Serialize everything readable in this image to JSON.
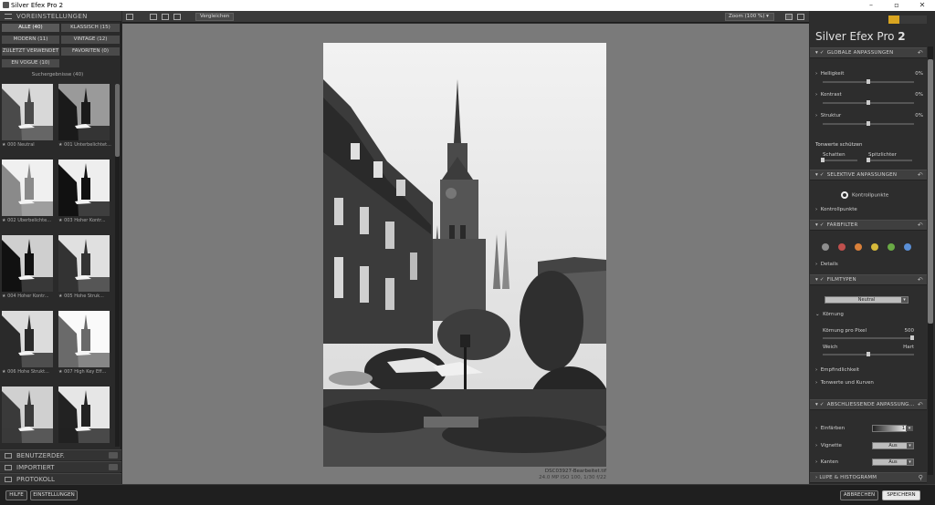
{
  "window": {
    "title": "Silver Efex Pro 2",
    "controls": [
      "–",
      "▫",
      "✕"
    ]
  },
  "left_panel": {
    "header": "VOREINSTELLUNGEN",
    "tabs": [
      {
        "label": "ALLE (40)"
      },
      {
        "label": "KLASSISCH (15)"
      },
      {
        "label": "MODERN (11)"
      },
      {
        "label": "VINTAGE (12)"
      },
      {
        "label": "ZULETZT VERWENDET"
      },
      {
        "label": "FAVORITEN (0)"
      },
      {
        "label": "EN VOGUE (10)"
      }
    ],
    "search_results": "Suchergebnisse (40)",
    "presets": [
      {
        "label": "★ 000 Neutral"
      },
      {
        "label": "★ 001 Unterbelichtet..."
      },
      {
        "label": "★ 002 Überbelichte..."
      },
      {
        "label": "★ 003 Hoher Kontr..."
      },
      {
        "label": "★ 004 Hoher Kontr..."
      },
      {
        "label": "★ 005 Hohe Struk..."
      },
      {
        "label": "★ 006 Hohe Strukt..."
      },
      {
        "label": "★ 007 High Key Eff..."
      },
      {
        "label": ""
      },
      {
        "label": ""
      }
    ],
    "sections": [
      {
        "label": "BENUTZERDEF."
      },
      {
        "label": "IMPORTIERT"
      },
      {
        "label": "PROTOKOLL"
      }
    ]
  },
  "toolbar": {
    "compare_label": "Vergleichen",
    "zoom_label": "Zoom (100 %)"
  },
  "canvas": {
    "filename": "DSC03927-Bearbeitet.tif",
    "meta": "24.0 MP ISO 100, 1/30 f/22"
  },
  "right_panel": {
    "brand_name": "Silver Efex Pro",
    "brand_version": "2",
    "global": {
      "header": "GLOBALE ANPASSUNGEN",
      "sliders": [
        {
          "label": "Helligkeit",
          "value": "0%",
          "level": 0.5
        },
        {
          "label": "Kontrast",
          "value": "0%",
          "level": 0.5
        },
        {
          "label": "Struktur",
          "value": "0%",
          "level": 0.5
        }
      ],
      "protect_title": "Tonwerte schützen",
      "protect_shadows": "Schatten",
      "protect_highlights": "Spitzlichter"
    },
    "selective": {
      "header": "SELEKTIVE ANPASSUNGEN",
      "control_points_button": "Kontrollpunkte",
      "control_points_label": "Kontrollpunkte"
    },
    "color_filter": {
      "header": "FARBFILTER",
      "dots": [
        "#8e8e8e",
        "#c0504d",
        "#d9803a",
        "#d6b93a",
        "#6aaa45",
        "#5a8fd6"
      ],
      "details": "Details"
    },
    "film": {
      "header": "FILMTYPEN",
      "preset": "Neutral",
      "grain_title": "Körnung",
      "grain_per_pixel_label": "Körnung pro Pixel",
      "grain_per_pixel_value": "500",
      "soft_label": "Weich",
      "hard_label": "Hart",
      "sensitivity": "Empfindlichkeit",
      "tone_curves": "Tonwerte und Kurven"
    },
    "final": {
      "header": "ABSCHLIESSENDE ANPASSUNG...",
      "toning_label": "Einfärben",
      "toning_value": "1",
      "vignette_label": "Vignette",
      "vignette_value": "Aus",
      "edges_label": "Kanten",
      "edges_value": "Aus"
    },
    "loupe": {
      "header": "LUPE & HISTOGRAMM"
    }
  },
  "bottom": {
    "help": "HILFE",
    "settings": "EINSTELLUNGEN",
    "cancel": "ABBRECHEN",
    "save": "SPEICHERN"
  }
}
